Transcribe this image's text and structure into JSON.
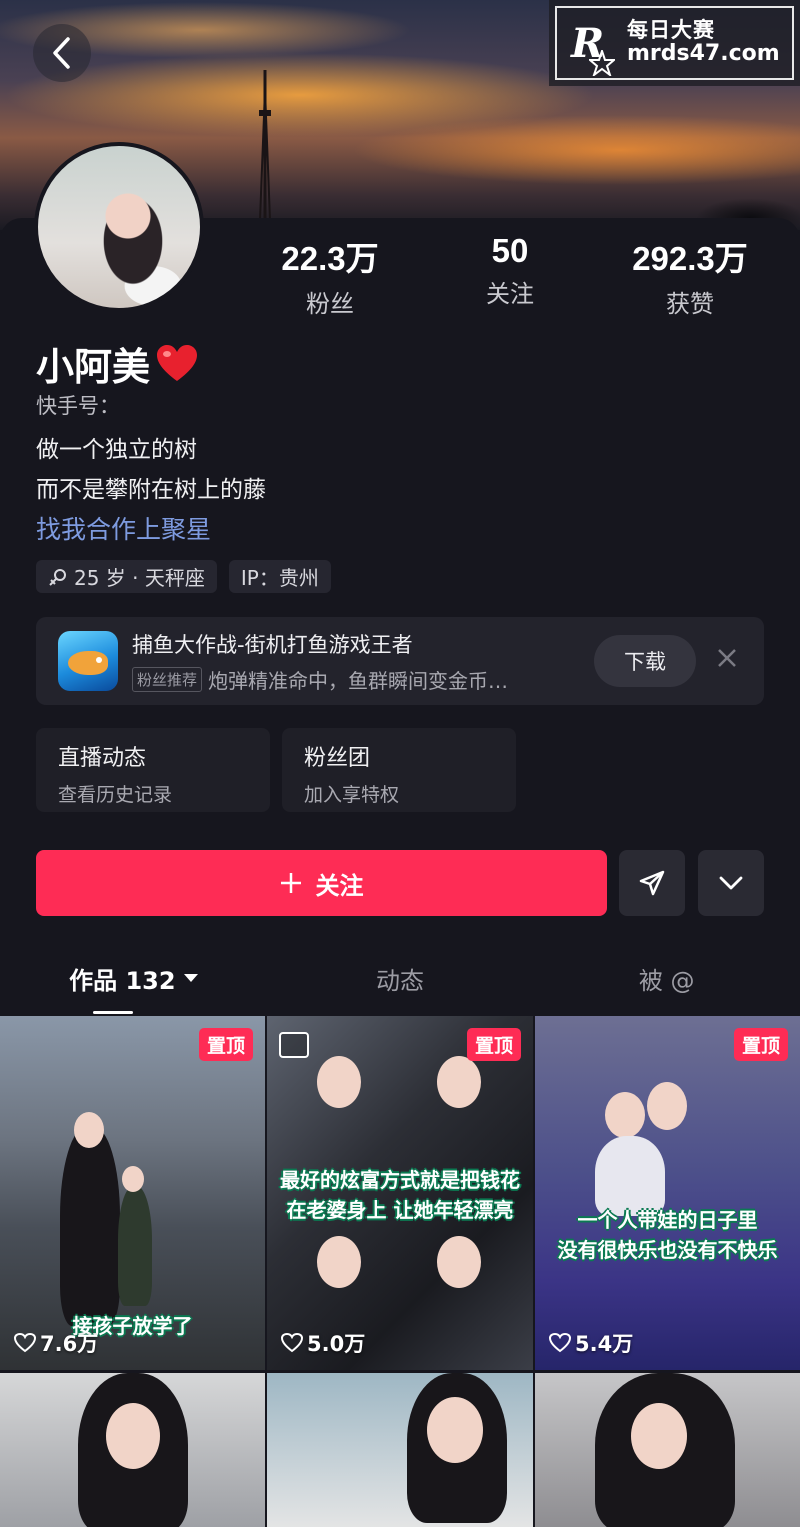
{
  "watermark": {
    "logo_letter": "R",
    "title": "每日大赛",
    "url": "mrds47.com"
  },
  "profile": {
    "name": "小阿美",
    "ks_id_label": "快手号：",
    "bio_lines": [
      "做一个独立的树",
      "而不是攀附在树上的藤"
    ],
    "collab_link": "找我合作上聚星",
    "stats": [
      {
        "value": "22.3万",
        "label": "粉丝"
      },
      {
        "value": "50",
        "label": "关注"
      },
      {
        "value": "292.3万",
        "label": "获赞"
      }
    ],
    "tags": [
      {
        "icon": "gender-female-icon",
        "text": "25 岁 · 天秤座"
      },
      {
        "text": "IP：贵州"
      }
    ]
  },
  "ad": {
    "title": "捕鱼大作战-街机打鱼游戏王者",
    "badge": "粉丝推荐",
    "desc": "炮弹精准命中，鱼群瞬间变金币…",
    "download_label": "下载"
  },
  "cards": [
    {
      "title": "直播动态",
      "subtitle": "查看历史记录"
    },
    {
      "title": "粉丝团",
      "subtitle": "加入享特权"
    }
  ],
  "actions": {
    "follow_label": "关注"
  },
  "tabs": [
    {
      "label": "作品 132",
      "active": true
    },
    {
      "label": "动态",
      "active": false
    },
    {
      "label": "被 @",
      "active": false
    }
  ],
  "videos": [
    {
      "pinned": "置顶",
      "likes": "7.6万",
      "caption_lines": [
        "接孩子放学了"
      ]
    },
    {
      "pinned": "置顶",
      "likes": "5.0万",
      "caption_lines": [
        "最好的炫富方式就是把钱花",
        "在老婆身上 让她年轻漂亮"
      ]
    },
    {
      "pinned": "置顶",
      "likes": "5.4万",
      "caption_lines": [
        "一个人带娃的日子里",
        "没有很快乐也没有不快乐"
      ]
    }
  ],
  "colors": {
    "accent": "#fe2c55",
    "background": "#16161e",
    "link": "#7e9be0"
  }
}
